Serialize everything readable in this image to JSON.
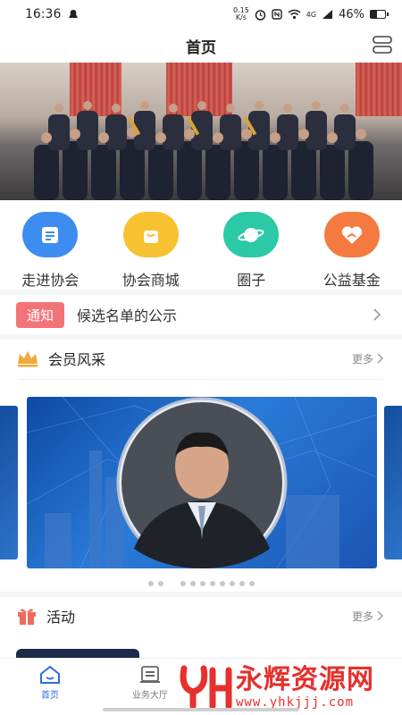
{
  "status_bar": {
    "time": "16:36",
    "net_speed_top": "0.15",
    "net_speed_bottom": "K/s",
    "signal": "4G",
    "battery": "46%",
    "battery_level": 0.46
  },
  "header": {
    "title": "首页",
    "menu_icon": "menu-icon"
  },
  "banner": {
    "image": "group-photo"
  },
  "quick_nav": [
    {
      "label": "走进协会",
      "icon": "document-icon",
      "color": "#3d8df0"
    },
    {
      "label": "协会商城",
      "icon": "shopping-bag-icon",
      "color": "#f7c22f"
    },
    {
      "label": "圈子",
      "icon": "planet-icon",
      "color": "#2cc9a6"
    },
    {
      "label": "公益基金",
      "icon": "heart-hand-icon",
      "color": "#f47a3f"
    }
  ],
  "notice": {
    "badge": "通知",
    "text": "候选名单的公示"
  },
  "members": {
    "title": "会员风采",
    "more": "更多",
    "icon": "crown-icon"
  },
  "activity": {
    "title": "活动",
    "more": "更多",
    "icon": "gift-icon"
  },
  "tabbar": [
    {
      "label": "首页",
      "icon": "home-icon",
      "active": true
    },
    {
      "label": "业务大厅",
      "icon": "hall-icon",
      "active": false
    }
  ],
  "watermark": {
    "title": "永辉资源网",
    "url": "www.yhkjjj.com"
  },
  "colors": {
    "accent": "#2b6de2",
    "notice": "#f37478",
    "crown": "#f0a93a",
    "gift": "#ef6a5c"
  }
}
